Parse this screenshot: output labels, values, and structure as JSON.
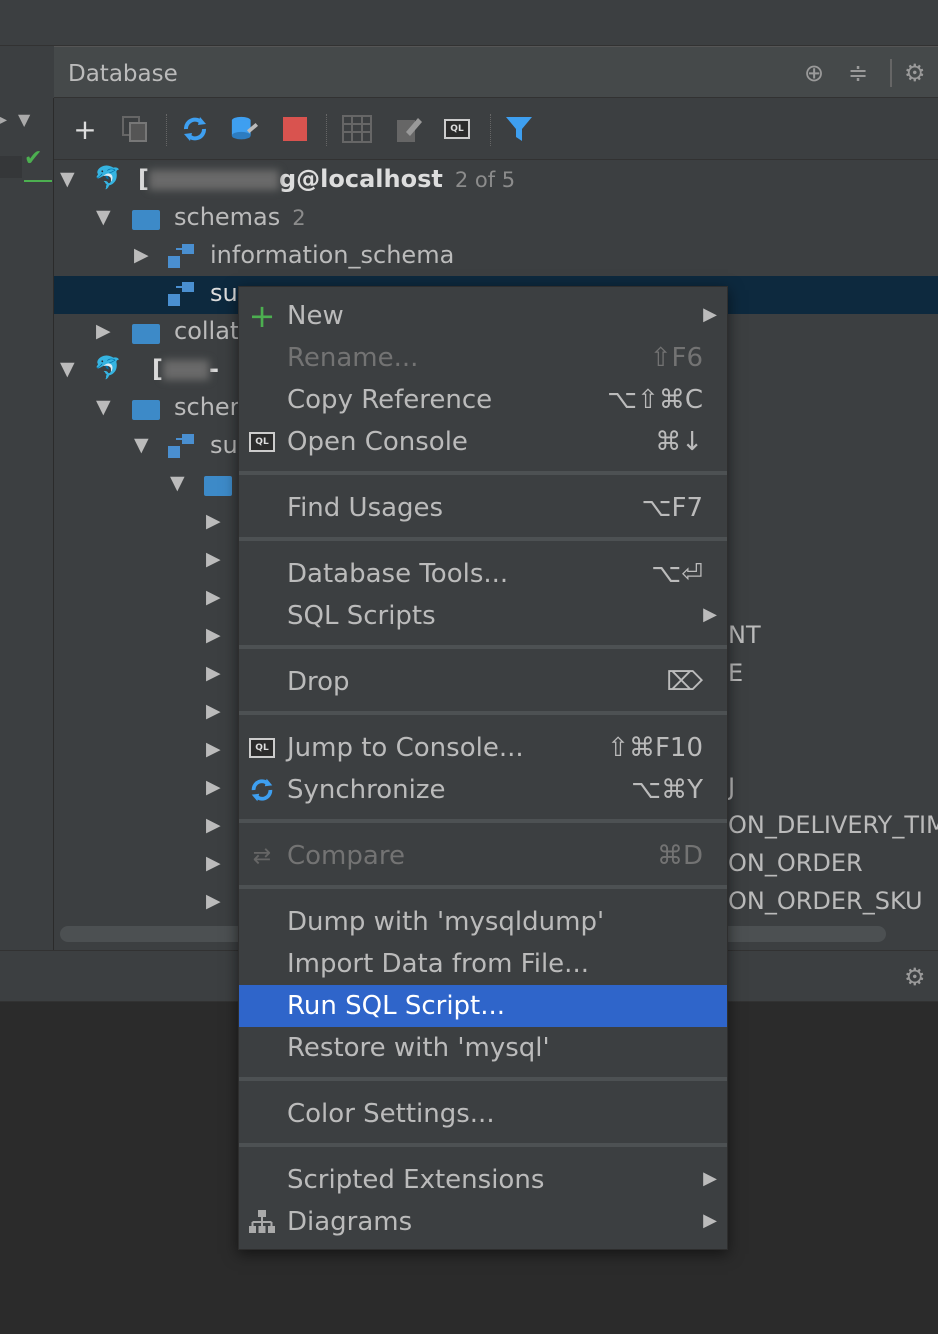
{
  "panel": {
    "title": "Database"
  },
  "tree": {
    "conn1": {
      "name_prefix": "[",
      "name_suffix": "g@localhost",
      "count": "2 of 5"
    },
    "schemas1": {
      "label": "schemas",
      "count": "2"
    },
    "information_schema": {
      "label": "information_schema"
    },
    "schema_selected": {
      "label": "su"
    },
    "collations": {
      "label": "collat"
    },
    "conn2": {
      "name_prefix": "[",
      "name_suffix": "-"
    },
    "schemas2": {
      "label": "scher"
    },
    "schema2": {
      "label": "su"
    },
    "tables": [
      {
        "suffix": ""
      },
      {
        "suffix": ""
      },
      {
        "suffix": ""
      },
      {
        "suffix": "NT"
      },
      {
        "suffix": "E"
      },
      {
        "suffix": ""
      },
      {
        "suffix": ""
      },
      {
        "suffix": "J"
      },
      {
        "suffix": "ON_DELIVERY_TIM"
      },
      {
        "suffix": "ON_ORDER"
      },
      {
        "suffix": "ON_ORDER_SKU"
      }
    ]
  },
  "menu": {
    "items": [
      {
        "label": "New",
        "shortcut": "",
        "submenu": true,
        "icon": "plus-icon",
        "disabled": false
      },
      {
        "label": "Rename...",
        "shortcut": "⇧F6",
        "submenu": false,
        "icon": "",
        "disabled": true
      },
      {
        "label": "Copy Reference",
        "shortcut": "⌥⇧⌘C",
        "submenu": false,
        "icon": "",
        "disabled": false
      },
      {
        "label": "Open Console",
        "shortcut": "⌘↓",
        "submenu": false,
        "icon": "console-icon",
        "disabled": false
      },
      {
        "label": "Find Usages",
        "shortcut": "⌥F7",
        "submenu": false,
        "icon": "",
        "disabled": false
      },
      {
        "label": "Database Tools...",
        "shortcut": "⌥⏎",
        "submenu": false,
        "icon": "",
        "disabled": false
      },
      {
        "label": "SQL Scripts",
        "shortcut": "",
        "submenu": true,
        "icon": "",
        "disabled": false
      },
      {
        "label": "Drop",
        "shortcut": "⌦",
        "submenu": false,
        "icon": "",
        "disabled": false
      },
      {
        "label": "Jump to Console...",
        "shortcut": "⇧⌘F10",
        "submenu": false,
        "icon": "console-icon",
        "disabled": false
      },
      {
        "label": "Synchronize",
        "shortcut": "⌥⌘Y",
        "submenu": false,
        "icon": "sync-icon",
        "disabled": false
      },
      {
        "label": "Compare",
        "shortcut": "⌘D",
        "submenu": false,
        "icon": "compare-icon",
        "disabled": true
      },
      {
        "label": "Dump with 'mysqldump'",
        "shortcut": "",
        "submenu": false,
        "icon": "",
        "disabled": false
      },
      {
        "label": "Import Data from File...",
        "shortcut": "",
        "submenu": false,
        "icon": "",
        "disabled": false
      },
      {
        "label": "Run SQL Script...",
        "shortcut": "",
        "submenu": false,
        "icon": "",
        "disabled": false,
        "active": true
      },
      {
        "label": "Restore with 'mysql'",
        "shortcut": "",
        "submenu": false,
        "icon": "",
        "disabled": false
      },
      {
        "label": "Color Settings...",
        "shortcut": "",
        "submenu": false,
        "icon": "",
        "disabled": false
      },
      {
        "label": "Scripted Extensions",
        "shortcut": "",
        "submenu": true,
        "icon": "",
        "disabled": false
      },
      {
        "label": "Diagrams",
        "shortcut": "",
        "submenu": true,
        "icon": "diagram-icon",
        "disabled": false
      }
    ]
  },
  "icons": {
    "console_text": "QL"
  },
  "colors": {
    "background": "#2b2b2b",
    "panel": "#3c3f41",
    "header": "#45494a",
    "selection": "#0d293e",
    "menu_active": "#2f65ca",
    "folder": "#3d8ac8",
    "accent_green": "#4caf50",
    "accent_red": "#d9534f",
    "accent_blue": "#3e9ff0"
  }
}
